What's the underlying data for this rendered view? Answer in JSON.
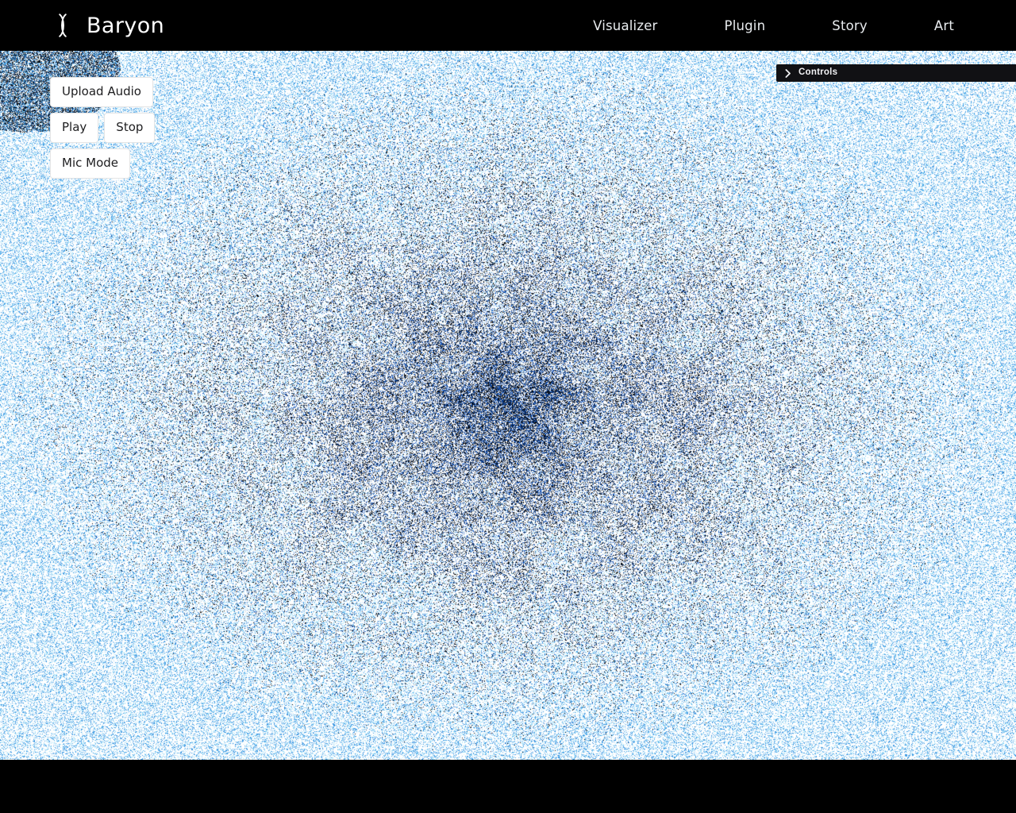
{
  "header": {
    "brand_name": "Baryon",
    "brand_mark_icon": "baryon-arcs-logo-icon",
    "nav": [
      {
        "label": "Visualizer"
      },
      {
        "label": "Plugin"
      },
      {
        "label": "Story"
      },
      {
        "label": "Art"
      }
    ]
  },
  "audio_controls": {
    "upload_label": "Upload Audio",
    "play_label": "Play",
    "stop_label": "Stop",
    "mic_label": "Mic Mode"
  },
  "controls_panel": {
    "title": "Controls",
    "expanded": false,
    "chevron_icon": "chevron-right-icon"
  },
  "visualizer": {
    "background_color": "#ffffff",
    "particle_colors": [
      "#ffffff",
      "#bfe9fb",
      "#7fd4f5",
      "#2b8fe0",
      "#1358c4",
      "#0b2f6b",
      "#000000"
    ],
    "accent_color": "#1d6fd0",
    "panel_color": "#111114",
    "header_color": "#000000"
  }
}
